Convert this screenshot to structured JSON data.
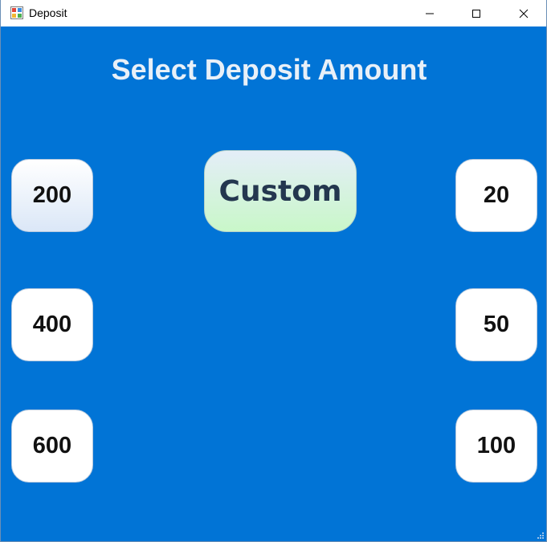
{
  "window": {
    "title": "Deposit",
    "app_icon": "winforms-app-icon",
    "controls": [
      "minimize-icon",
      "maximize-icon",
      "close-icon"
    ]
  },
  "heading": "Select Deposit Amount",
  "amounts_left": [
    "200",
    "400",
    "600"
  ],
  "amounts_right": [
    "20",
    "50",
    "100"
  ],
  "custom_label": "Custom",
  "colors": {
    "background": "#0174d6",
    "heading": "#e8f0f8",
    "button_face": "#ffffff",
    "custom_gradient_top": "#e4eef8",
    "custom_gradient_bottom": "#c9f7c9",
    "custom_text": "#24374f"
  }
}
